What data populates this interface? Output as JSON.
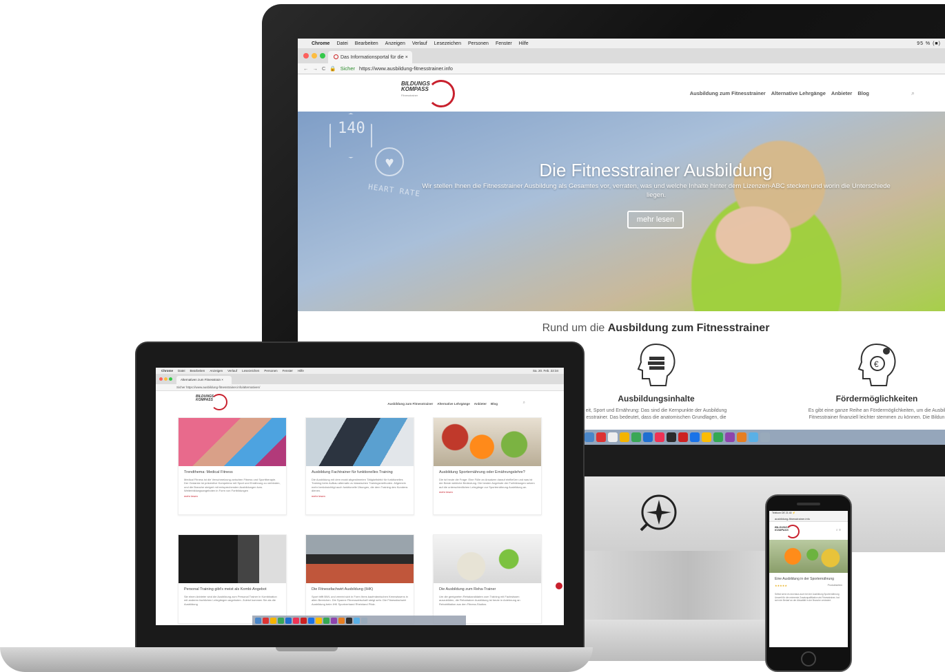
{
  "imac": {
    "menubar": {
      "apple": "",
      "items": [
        "Chrome",
        "Datei",
        "Bearbeiten",
        "Anzeigen",
        "Verlauf",
        "Lesezeichen",
        "Personen",
        "Fenster",
        "Hilfe"
      ],
      "status": "95 % (■)"
    },
    "browser": {
      "tab_title": "Das Informationsportal für die ×",
      "secure_label": "Sicher",
      "url": "https://www.ausbildung-fitnesstrainer.info"
    },
    "site": {
      "logo_line1": "BILDUNGS",
      "logo_line2": "KOMPASS",
      "logo_sub": "Fitnesstrainer",
      "nav": [
        "Ausbildung zum Fitnesstrainer",
        "Alternative Lehrgänge",
        "Anbieter",
        "Blog"
      ],
      "search_icon": "⌕",
      "hero": {
        "hex_number": "140",
        "heart_rate_label": "HEART RATE",
        "title": "Die Fitnesstrainer Ausbildung",
        "subtitle": "Wir stellen Ihnen die Fitnesstrainer Ausbildung als Gesamtes vor, verraten, was und welche Inhalte hinter dem Lizenzen-ABC stecken und worin die Unterschiede liegen.",
        "button": "mehr lesen"
      },
      "section_title_prefix": "Rund um die ",
      "section_title_bold": "Ausbildung zum Fitnesstrainer",
      "features": [
        {
          "title": "Ausbildungsinhalte",
          "text": "eit, Sport und Ernährung: Das sind die Kernpunkte der Ausbildung",
          "text2": "esstrainer. Das bedeutet, dass die anatomischen Grundlagen, die"
        },
        {
          "title": "Fördermöglichkeiten",
          "text": "Es gibt eine ganze Reihe an Fördermöglichkeiten, um die Ausbil",
          "text2": "Fitnesstrainer finanziell leichter stemmen zu können. Die Bildun"
        }
      ]
    }
  },
  "macbook": {
    "menubar": {
      "items": [
        "Chrome",
        "Datei",
        "Bearbeiten",
        "Anzeigen",
        "Verlauf",
        "Lesezeichen",
        "Personen",
        "Fenster",
        "Hilfe"
      ],
      "status": "Sa. 20. Feb. 22:34"
    },
    "tab_title": "Alternativen zum Fitnesstrain ×",
    "url": "Sicher  https://www.ausbildung-fitnesstrainer.info/alternativen/",
    "logo_line1": "BILDUNGS",
    "logo_line2": "KOMPASS",
    "nav": [
      "Ausbildung zum Fitnesstrainer",
      "Alternative Lehrgänge",
      "Anbieter",
      "Blog"
    ],
    "search_icon": "⌕",
    "cards": [
      {
        "title": "Trendthema: Medical Fitness",
        "text": "Medical Fitness ist die Verschmelzung zwischen Fitness und Sporttherapie. Der Gedanke ist präventive Kompetenz mit Sport und Ernährung zu verbinden, und die Branche steigert mit entsprechenden Ausbildungen bzw. Weiterbildungsangeboten in Form von Fortbildungen",
        "more": "mehr lesen"
      },
      {
        "title": "Ausbildung Fachtrainer für funktionelles Training",
        "text": "Die Ausbildung mit dem exakt abgestimmten Tätigkeitsfeld für funktionelles Training beim Aufbau alternativ zu klassischen Trainingsmethoden. Allgemein mehr berücksichtigt auch funktionelle Übungen, die dem Training des Kundens dienen.",
        "more": "mehr lesen"
      },
      {
        "title": "Ausbildung Sporternährung oder Ernährungslehre?",
        "text": "Die ist heute die Frage: Eine Fülle an Ansatzen darauf einfließen und was ist der Beste wirkliche Bedeutung. Die besten Angebote der Fortbildungen setzen auf die unterschiedlichen Lehrgänge zur Sporternährung Ausbildung an.",
        "more": "mehr lesen"
      },
      {
        "title": "Personal Training gibt's meist als Kombi-Angebot",
        "text": "Sie einen Anbieter sind die Ausbildung zum Personal Trainer in Kombination mit anderen fachlichen Lehrgängen angeboten. Zuletzt kommen Sie als die Ausbildung"
      },
      {
        "title": "Die Fitnessfachwirt Ausbildung (IHK)",
        "text": "Sport trifft BWL und vereint sich in Form Ihres kaufmännischen Kennwissens in allen Bereichen. Die Spanne Fitnesswirtschaft steigt sehr. Die Fitnessfachwirt Ausbildung beim IHK Sportverband Rheinland Pfalz."
      },
      {
        "title": "Die Ausbildung zum Reha-Trainer",
        "text": "Um die geeigneten Rehakandidaten zum Training mit Fachwissen auszubilden, die Rehatrainer Ausbildung ist heute in Anlehnung an Rehabilitation aus den Fitness-Studios."
      }
    ]
  },
  "iphone": {
    "status": "Telekom DE    21:40    ⚡",
    "url": "ausbildung-fitnesstrainer.info",
    "logo_line1": "BILDUNGS",
    "logo_line2": "KOMPASS",
    "icons": "⌕  ≡",
    "post_title": "Eine Ausbildung in der Sporternährung",
    "stars": "★★★★★",
    "meta_right": "Produktseiten",
    "text": "Selbst wenn es durchaus auch bei der Ausbildung Sporternährung Umwelt für die extremste Zusatzqualifikation als Fitnesstrainer, hat sich der Bedarf an der Aktualität in der Branche verändert."
  },
  "colors": {
    "brand_red": "#c8202d",
    "hero_green": "#a7cf4a",
    "hero_blue": "#7f9ec7"
  }
}
